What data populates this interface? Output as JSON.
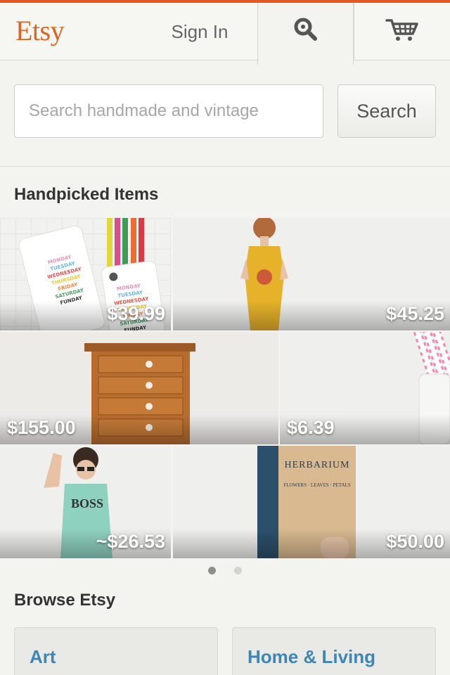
{
  "header": {
    "logo": "Etsy",
    "sign_in_label": "Sign In",
    "search_tab_icon": "search-icon",
    "cart_icon": "cart-icon",
    "accent_color": "#e05a1f"
  },
  "search": {
    "placeholder": "Search handmade and vintage",
    "value": "",
    "button_label": "Search"
  },
  "handpicked": {
    "title": "Handpicked Items",
    "items": [
      {
        "price": "$39.99"
      },
      {
        "price": "$45.25"
      },
      {
        "price": "$155.00"
      },
      {
        "price": "$6.39"
      },
      {
        "price": "~$26.53"
      },
      {
        "price": "$50.00"
      }
    ],
    "photo_text": {
      "phone_case": [
        "MONDAY",
        "TUESDAY",
        "WEDNESDAY",
        "THURSDAY",
        "FRIDAY",
        "SATURDAY",
        "FUNDAY"
      ],
      "tank_top": "BOSS",
      "book_title": "HERBARIUM",
      "book_subtitle": "FLOWERS · LEAVES · PETALS"
    },
    "pager": {
      "pages": 2,
      "active": 0
    }
  },
  "browse": {
    "title": "Browse Etsy",
    "categories": [
      {
        "label": "Art"
      },
      {
        "label": "Home & Living"
      }
    ]
  }
}
